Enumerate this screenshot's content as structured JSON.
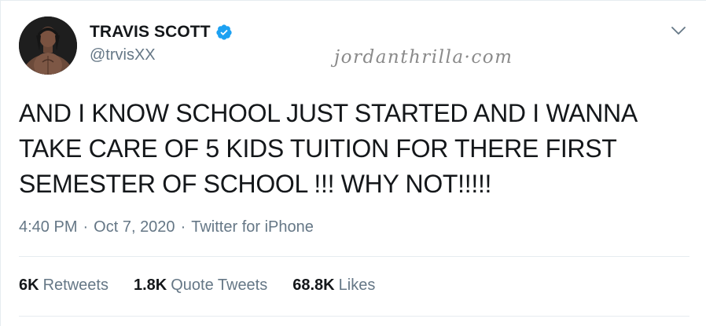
{
  "author": {
    "display_name": "TRAVIS SCOTT",
    "handle": "@trvisXX",
    "verified": true
  },
  "watermark": "jordanthrilla·com",
  "tweet": {
    "text_lines": [
      "AND I KNOW SCHOOL JUST STARTED AND I WANNA",
      "TAKE CARE OF 5 KIDS TUITION FOR THERE FIRST",
      "SEMESTER OF SCHOOL !!! WHY NOT!!!!!"
    ],
    "time": "4:40 PM",
    "date": "Oct 7, 2020",
    "source": "Twitter for iPhone",
    "separator": "·"
  },
  "stats": {
    "retweets": {
      "count": "6K",
      "label": "Retweets"
    },
    "quote_tweets": {
      "count": "1.8K",
      "label": "Quote Tweets"
    },
    "likes": {
      "count": "68.8K",
      "label": "Likes"
    }
  },
  "icons": {
    "verified": "verified-badge-icon",
    "menu": "chevron-down-icon"
  },
  "colors": {
    "verified_blue": "#1da1f2",
    "secondary_text": "#657786",
    "primary_text": "#14171a",
    "divider": "#e6ecf0"
  }
}
